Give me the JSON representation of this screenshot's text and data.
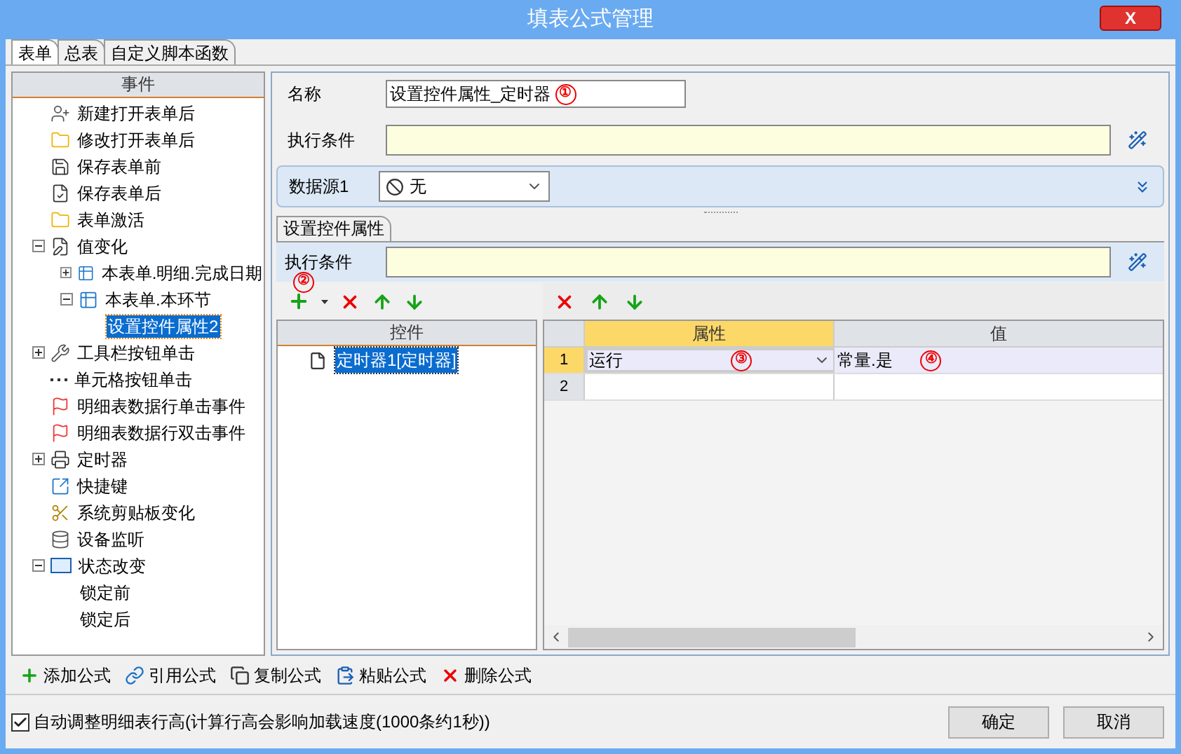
{
  "window": {
    "title": "填表公式管理",
    "close_label": "X"
  },
  "tabs": [
    {
      "label": "表单",
      "selected": true
    },
    {
      "label": "总表",
      "selected": false
    },
    {
      "label": "自定义脚本函数",
      "selected": false
    }
  ],
  "event_tree": {
    "header": "事件",
    "items": [
      {
        "label": "新建打开表单后",
        "selected": false
      },
      {
        "label": "修改打开表单后",
        "selected": false
      },
      {
        "label": "保存表单前",
        "selected": false
      },
      {
        "label": "保存表单后",
        "selected": false
      },
      {
        "label": "表单激活",
        "selected": false
      },
      {
        "label": "值变化",
        "selected": false,
        "expanded": true,
        "children": [
          {
            "label": "本表单.明细.完成日期",
            "selected": false,
            "expanded": false
          },
          {
            "label": "本表单.本环节",
            "selected": false,
            "expanded": true,
            "children": [
              {
                "label": "设置控件属性2",
                "selected": true
              }
            ]
          }
        ]
      },
      {
        "label": "工具栏按钮单击",
        "selected": false,
        "expanded": false
      },
      {
        "label": "单元格按钮单击",
        "selected": false
      },
      {
        "label": "明细表数据行单击事件",
        "selected": false
      },
      {
        "label": "明细表数据行双击事件",
        "selected": false
      },
      {
        "label": "定时器",
        "selected": false,
        "expanded": false
      },
      {
        "label": "快捷键",
        "selected": false
      },
      {
        "label": "系统剪贴板变化",
        "selected": false
      },
      {
        "label": "设备监听",
        "selected": false
      },
      {
        "label": "状态改变",
        "selected": false,
        "expanded": true,
        "children": [
          {
            "label": "锁定前",
            "selected": false
          },
          {
            "label": "锁定后",
            "selected": false
          }
        ]
      }
    ]
  },
  "form": {
    "name_label": "名称",
    "name_value": "设置控件属性_定时器",
    "name_annotation": "①",
    "condition_label": "执行条件",
    "datasource_label": "数据源1",
    "datasource_value": "无"
  },
  "section": {
    "tab": "设置控件属性",
    "condition_label": "执行条件",
    "annotation": "②",
    "controls": {
      "header": "控件",
      "items": [
        {
          "label": "定时器1[定时器]",
          "selected": true
        }
      ]
    },
    "grid": {
      "columns": [
        "属性",
        "值"
      ],
      "rows": [
        {
          "number": "1",
          "property": "运行",
          "value": "常量.是",
          "selected": true,
          "property_annotation": "③",
          "value_annotation": "④"
        },
        {
          "number": "2",
          "selected": false
        }
      ]
    }
  },
  "toolbar": [
    "添加公式",
    "引用公式",
    "复制公式",
    "粘贴公式",
    "删除公式"
  ],
  "footer": {
    "checkbox": {
      "label": "自动调整明细表行高(计算行高会影响加载速度(1000条约1秒))",
      "checked": true
    },
    "buttons": [
      "确定",
      "取消"
    ]
  }
}
